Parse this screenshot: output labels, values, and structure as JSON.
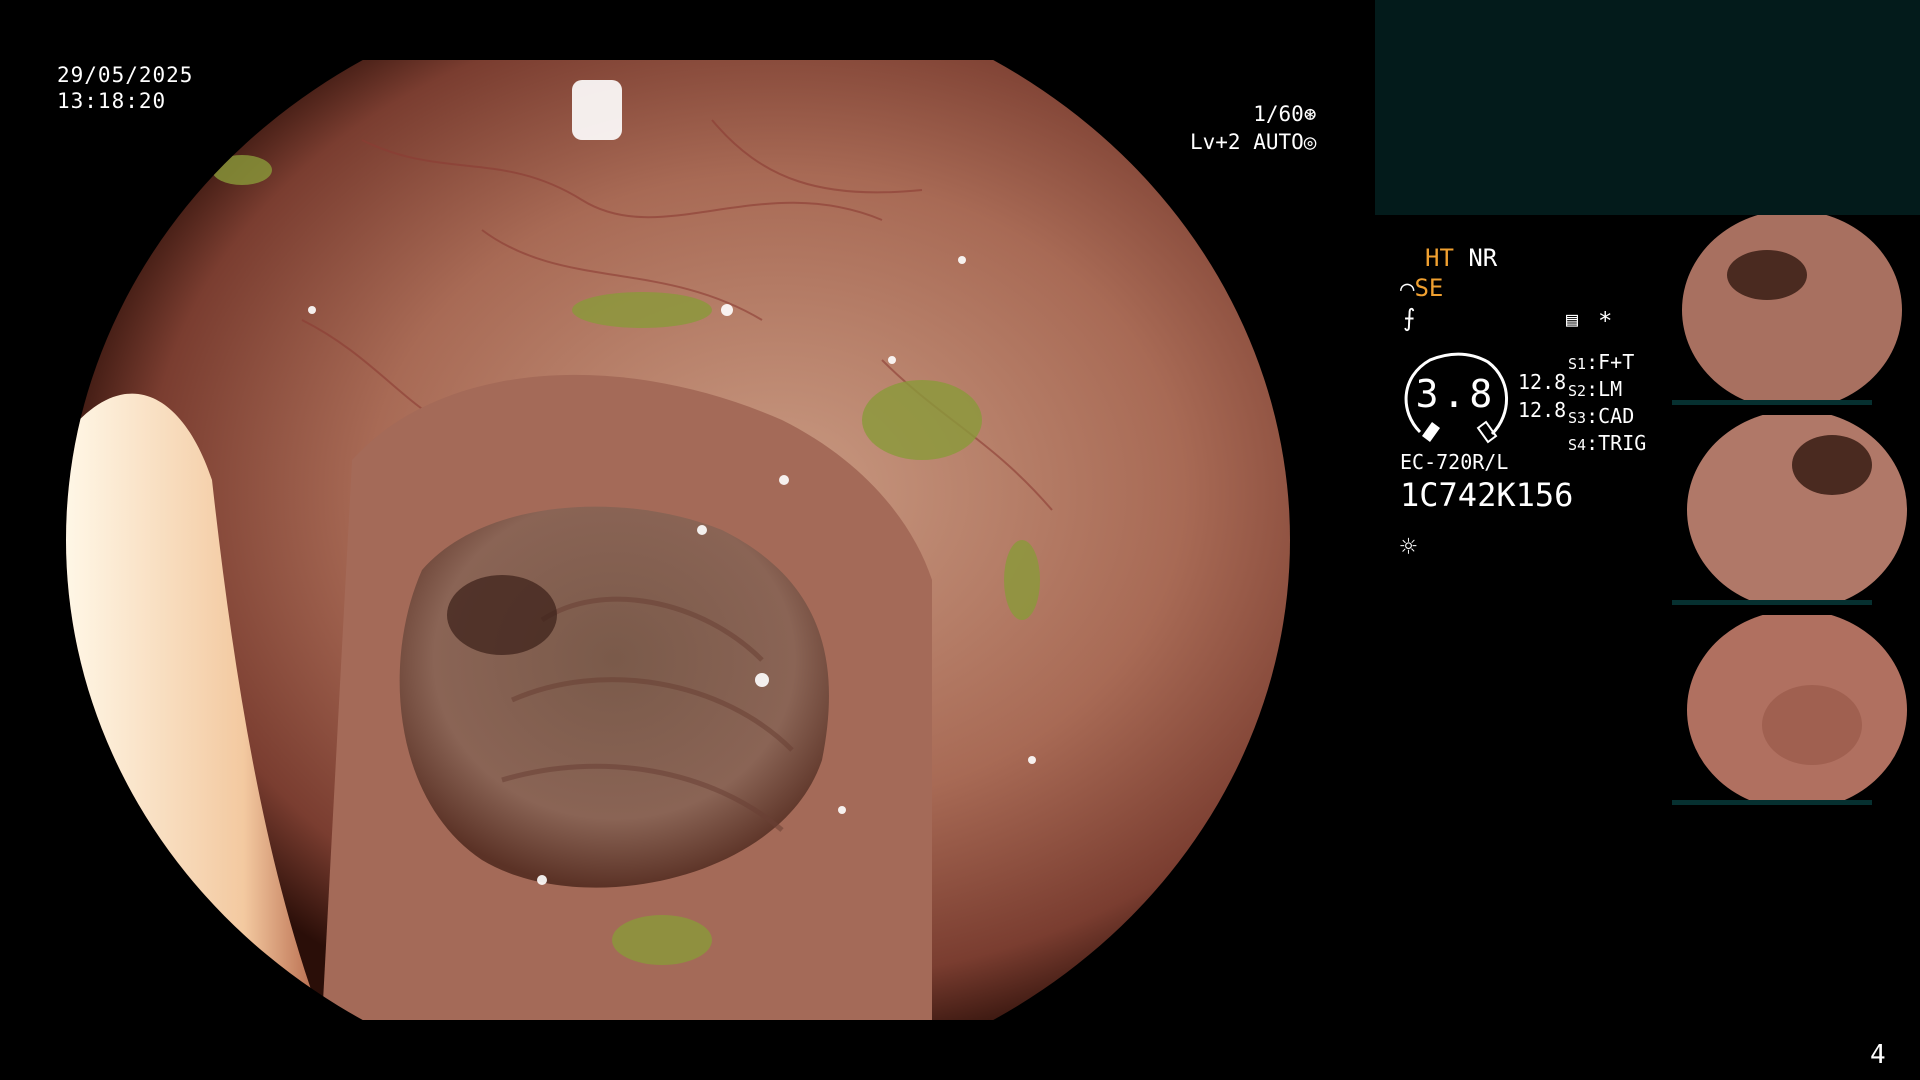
{
  "datetime": {
    "date": "29/05/2025",
    "time": "13:18:20"
  },
  "exposure": {
    "shutter": "1/60",
    "level": "Lv+2 AUTO"
  },
  "modes": {
    "ht": "HT",
    "nr": "NR",
    "se": "SE"
  },
  "gauge": {
    "value": "3.8"
  },
  "distances": [
    "12.8",
    "12.8"
  ],
  "settings": [
    {
      "key": "S1",
      "value": "F+T"
    },
    {
      "key": "S2",
      "value": "LM"
    },
    {
      "key": "S3",
      "value": "CAD"
    },
    {
      "key": "S4",
      "value": "TRIG"
    }
  ],
  "scope": {
    "model": "EC-720R/L",
    "serial": "1C742K156"
  },
  "thumbnails_count": 3,
  "page_number": "4",
  "colors": {
    "accent": "#f0a030",
    "panel": "#031b1b",
    "tissue": "#a86a55"
  }
}
